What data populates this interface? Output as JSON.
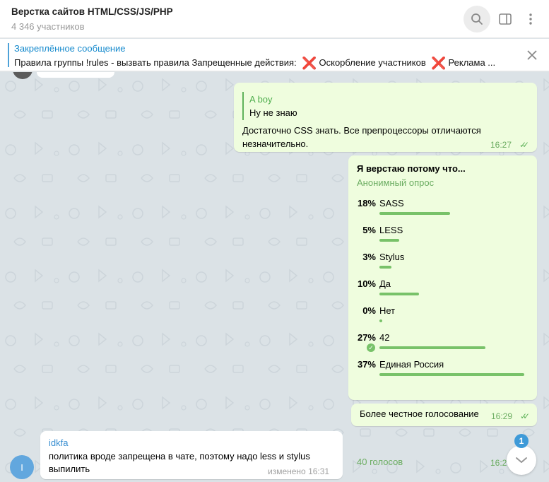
{
  "header": {
    "title": "Верстка сайтов HTML/CSS/JS/PHP",
    "subtitle": "4 346 участников"
  },
  "pinned": {
    "title": "Закреплённое сообщение",
    "text_part1": "Правила группы !rules - вызвать правила  Запрещенные действия: ",
    "text_part2": "Оскорбление участников ",
    "text_part3": "Реклама ...",
    "mark": "❌"
  },
  "messages": {
    "reply": {
      "quote_name": "A boy",
      "quote_text": "Ну не знаю",
      "text": "Достаточно CSS знать. Все препроцессоры отличаются незначительно.",
      "time": "16:27",
      "checks": "✓✓"
    },
    "poll": {
      "question": "Я верстаю потому что...",
      "type": "Анонимный опрос",
      "options": [
        {
          "pct": "18%",
          "label": "SASS",
          "value": 0.18
        },
        {
          "pct": "5%",
          "label": "LESS",
          "value": 0.05
        },
        {
          "pct": "3%",
          "label": "Stylus",
          "value": 0.03
        },
        {
          "pct": "10%",
          "label": "Да",
          "value": 0.1
        },
        {
          "pct": "0%",
          "label": "Нет",
          "value": 0.0
        },
        {
          "pct": "27%",
          "label": "42",
          "value": 0.27
        },
        {
          "pct": "37%",
          "label": "Единая Россия",
          "value": 0.37
        }
      ],
      "chosen_index": 5,
      "votes": "40 голосов",
      "time": "16:29",
      "checks": "✓✓"
    },
    "short": {
      "text": "Более честное голосование",
      "time": "16:29",
      "checks": "✓✓"
    },
    "incoming": {
      "sender": "idkfa",
      "text": "политика вроде запрещена в чате, поэтому надо less и stylus выпилить",
      "edited": "изменено 16:31",
      "avatar_letter": "I"
    }
  },
  "scroll": {
    "unread": "1"
  },
  "colors": {
    "accent": "#168acd",
    "outgoing_bg": "#effdde",
    "poll_bar": "#78c269",
    "danger": "#e3262c"
  }
}
